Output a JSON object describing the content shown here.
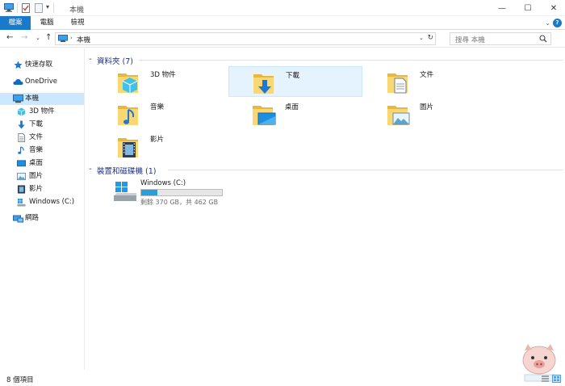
{
  "window": {
    "title": "本機",
    "minimize": "—",
    "maximize": "☐",
    "close": "✕"
  },
  "ribbon": {
    "tabs": [
      "檔案",
      "電腦",
      "檢視"
    ]
  },
  "address_bar": {
    "path": "本機",
    "search_placeholder": "搜尋 本機"
  },
  "sidebar": {
    "items": [
      {
        "label": "快速存取",
        "icon": "star-icon"
      },
      {
        "label": "OneDrive",
        "icon": "cloud-icon"
      },
      {
        "label": "本機",
        "icon": "computer-icon"
      },
      {
        "label": "3D 物件",
        "icon": "cube-icon"
      },
      {
        "label": "下載",
        "icon": "download-arrow-icon"
      },
      {
        "label": "文件",
        "icon": "document-icon"
      },
      {
        "label": "音樂",
        "icon": "music-note-icon"
      },
      {
        "label": "桌面",
        "icon": "desktop-icon"
      },
      {
        "label": "圖片",
        "icon": "picture-icon"
      },
      {
        "label": "影片",
        "icon": "film-icon"
      },
      {
        "label": "Windows (C:)",
        "icon": "drive-icon"
      },
      {
        "label": "網路",
        "icon": "network-icon"
      }
    ]
  },
  "content": {
    "folders_header": "資料夾 (7)",
    "folders": [
      {
        "name": "3D 物件",
        "icon": "folder-3d-icon"
      },
      {
        "name": "下載",
        "icon": "folder-download-icon"
      },
      {
        "name": "文件",
        "icon": "folder-document-icon"
      },
      {
        "name": "音樂",
        "icon": "folder-music-icon"
      },
      {
        "name": "桌面",
        "icon": "folder-desktop-icon"
      },
      {
        "name": "圖片",
        "icon": "folder-picture-icon"
      },
      {
        "name": "影片",
        "icon": "folder-film-icon"
      }
    ],
    "devices_header": "裝置和磁碟機 (1)",
    "drive": {
      "name": "Windows (C:)",
      "free_text": "剩餘 370 GB，共 462 GB",
      "used_fraction": 0.2
    }
  },
  "statusbar": {
    "item_count": "8 個項目"
  },
  "colors": {
    "accent": "#1979ca",
    "selected_bg": "#cce8ff",
    "group_title": "#1e3287",
    "folder_yellow": "#f8d775",
    "drive_fill": "#26a0da"
  }
}
